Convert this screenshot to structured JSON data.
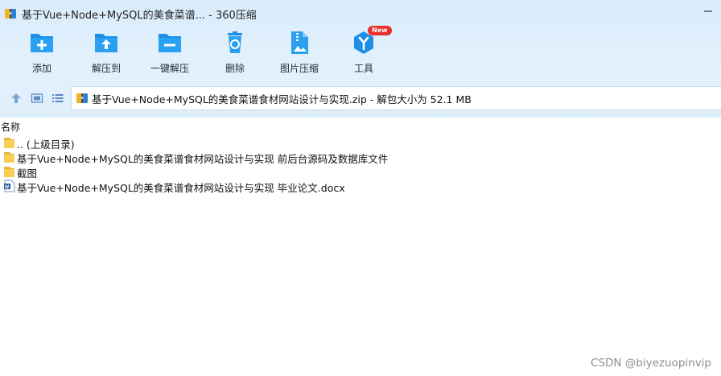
{
  "window": {
    "title": "基于Vue+Node+MySQL的美食菜谱... - 360压缩"
  },
  "colors": {
    "accent": "#1a8be0",
    "chrome_bg": "#ddeefb",
    "folder": "#f5c842",
    "badge": "#e9302a"
  },
  "toolbar": {
    "items": [
      {
        "label": "添加",
        "icon": "add-icon"
      },
      {
        "label": "解压到",
        "icon": "extract-to-icon"
      },
      {
        "label": "一键解压",
        "icon": "one-click-extract-icon"
      },
      {
        "label": "删除",
        "icon": "delete-icon"
      },
      {
        "label": "图片压缩",
        "icon": "image-compress-icon"
      },
      {
        "label": "工具",
        "icon": "tools-icon",
        "badge": "New"
      }
    ]
  },
  "address": {
    "path": "基于Vue+Node+MySQL的美食菜谱食材网站设计与实现.zip - 解包大小为 52.1 MB"
  },
  "list": {
    "column_name": "名称",
    "rows": [
      {
        "label": ".. (上级目录)",
        "icon": "folder-icon"
      },
      {
        "label": "基于Vue+Node+MySQL的美食菜谱食材网站设计与实现 前后台源码及数据库文件",
        "icon": "folder-icon"
      },
      {
        "label": "截图",
        "icon": "folder-icon"
      },
      {
        "label": "基于Vue+Node+MySQL的美食菜谱食材网站设计与实现 毕业论文.docx",
        "icon": "word-doc-icon"
      }
    ]
  },
  "watermark": "CSDN @biyezuopinvip"
}
